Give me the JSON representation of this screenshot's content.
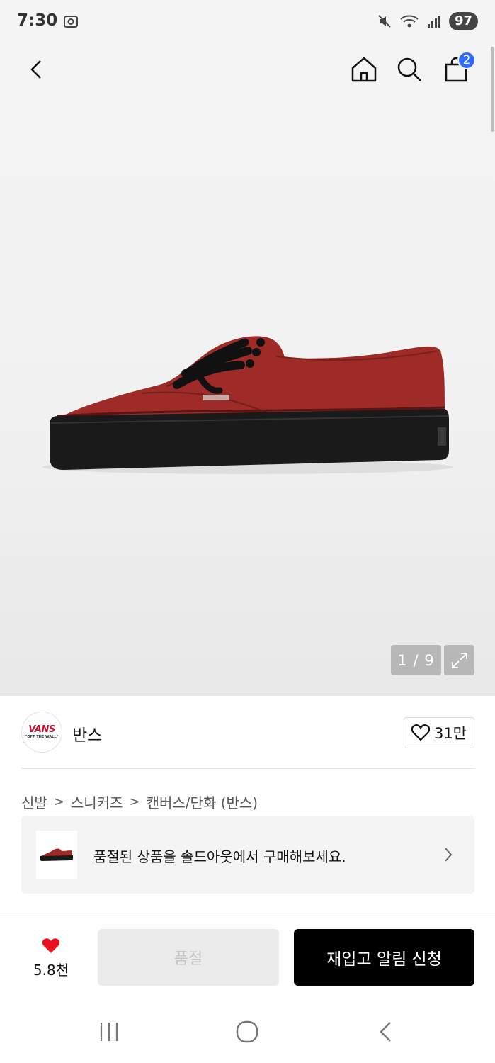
{
  "status_bar": {
    "time": "7:30",
    "battery": "97"
  },
  "header": {
    "cart_badge": "2"
  },
  "gallery": {
    "counter": "1 / 9"
  },
  "brand": {
    "logo_text": "VANS",
    "logo_subtext": "\"OFF THE WALL\"",
    "name": "반스",
    "like_count": "31만"
  },
  "breadcrumb": {
    "items": [
      "신발",
      "스니커즈",
      "캔버스/단화 (반스)"
    ]
  },
  "soldout_banner": {
    "text": "품절된 상품을 솔드아웃에서 구매해보세요."
  },
  "bottom_bar": {
    "wish_count": "5.8천",
    "soldout_label": "품절",
    "restock_label": "재입고 알림 신청"
  },
  "colors": {
    "accent_blue": "#2f6bff",
    "heart_red": "#e8101e",
    "shoe_red": "#9e2b27",
    "button_black": "#000000"
  },
  "icons": [
    "back-arrow-icon",
    "home-icon",
    "search-icon",
    "shopping-bag-icon",
    "expand-icon",
    "heart-outline-icon",
    "heart-filled-icon",
    "chevron-right-icon",
    "recents-icon",
    "home-circle-icon",
    "system-back-icon"
  ]
}
